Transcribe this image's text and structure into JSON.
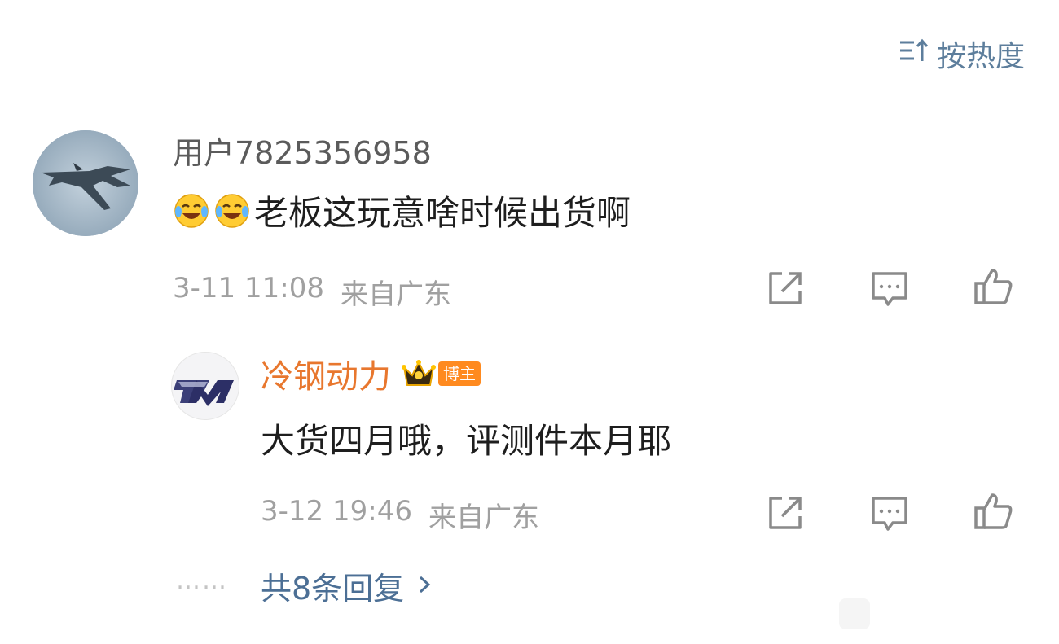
{
  "sort": {
    "icon": "sort-icon",
    "label": "按热度"
  },
  "comment": {
    "username": "用户7825356958",
    "emojis": [
      "laugh-cry-emoji",
      "laugh-cry-emoji"
    ],
    "text": "老板这玩意啥时候出货啊",
    "date": "3-11 11:08",
    "location": "来自广东",
    "actions": [
      "share-icon",
      "comment-icon",
      "like-icon"
    ]
  },
  "reply": {
    "username": "冷钢动力",
    "badge": "博主",
    "text": "大货四月哦，评测件本月耶",
    "date": "3-12 19:46",
    "location": "来自广东",
    "actions": [
      "share-icon",
      "comment-icon",
      "like-icon"
    ]
  },
  "more": {
    "dots": "……",
    "label": "共8条回复",
    "icon": "chevron-right-icon"
  },
  "colors": {
    "link": "#4c6f95",
    "blogger_name": "#e8772e",
    "badge": "#ff8a1f",
    "meta": "#a0a0a0"
  }
}
